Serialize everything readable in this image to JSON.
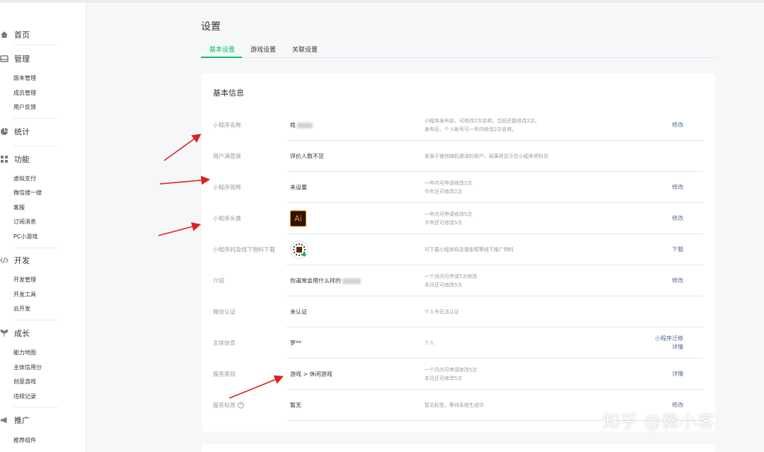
{
  "sidebar": {
    "home": "首页",
    "manage": "管理",
    "manage_items": [
      "版本管理",
      "成员管理",
      "用户反馈"
    ],
    "stats": "统计",
    "features": "功能",
    "features_items": [
      "虚拟支付",
      "微信搜一搜",
      "客服",
      "订阅消息",
      "PC小游戏"
    ],
    "dev": "开发",
    "dev_items": [
      "开发管理",
      "开发工具",
      "云开发"
    ],
    "growth": "成长",
    "growth_items": [
      "能力地图",
      "主体信用分",
      "创意游戏",
      "违规记录"
    ],
    "promote": "推广",
    "promote_items": [
      "推荐组件"
    ]
  },
  "page": {
    "title": "设置",
    "tabs": [
      "基本设置",
      "游戏设置",
      "关联设置"
    ],
    "active_tab": "基本设置"
  },
  "basic_info": {
    "title": "基本信息",
    "rows": [
      {
        "label": "小程序名称",
        "value": "姓",
        "desc": [
          "小程序发布前，可修改2次名称。当前还能修改2次。",
          "发布后，个人帐号可一年内修改2次名称。"
        ],
        "action": [
          "修改"
        ]
      },
      {
        "label": "用户满意度",
        "value": "评价人数不足",
        "desc": [
          "来源于微信随机邀请的用户，结果将显示在小程序资料页"
        ],
        "action": []
      },
      {
        "label": "小程序简称",
        "value": "未设置",
        "desc": [
          "一年内可申请修改2次",
          "今年还可修改2次"
        ],
        "action": [
          "修改"
        ]
      },
      {
        "label": "小程序头像",
        "value": "Ai",
        "desc": [
          "一年内可申请修改5次",
          "今年还可修改5次"
        ],
        "action": [
          "修改"
        ]
      },
      {
        "label": "小程序码及线下物料下载",
        "value": "",
        "desc": [
          "可下载小程序码及搜索框等线下推广物料"
        ],
        "action": [
          "下载"
        ]
      },
      {
        "label": "介绍",
        "value": "你逼常会用什么样的",
        "desc": [
          "一个月内可申请5次修改",
          "本月还可修改5次"
        ],
        "action": [
          "修改"
        ]
      },
      {
        "label": "微信认证",
        "value": "未认证",
        "desc": [
          "个人号无法认证"
        ],
        "action": []
      },
      {
        "label": "主体信息",
        "value": "罗**",
        "desc": [
          "个人"
        ],
        "action": [
          "小程序迁移",
          "详情"
        ]
      },
      {
        "label": "服务类目",
        "value": "游戏 > 休闲游戏",
        "desc": [
          "一个月内可申请修改5次",
          "本月还可修改5次"
        ],
        "action": [
          "详情"
        ]
      },
      {
        "label": "服务标签",
        "value": "暂无",
        "desc": [
          "暂无标签，等待系统生成中"
        ],
        "action": [
          "修改"
        ]
      }
    ]
  },
  "watermark": "知乎 @微小客",
  "colors": {
    "accent": "#07c160",
    "link": "#576b95",
    "arrow": "#e02020"
  }
}
